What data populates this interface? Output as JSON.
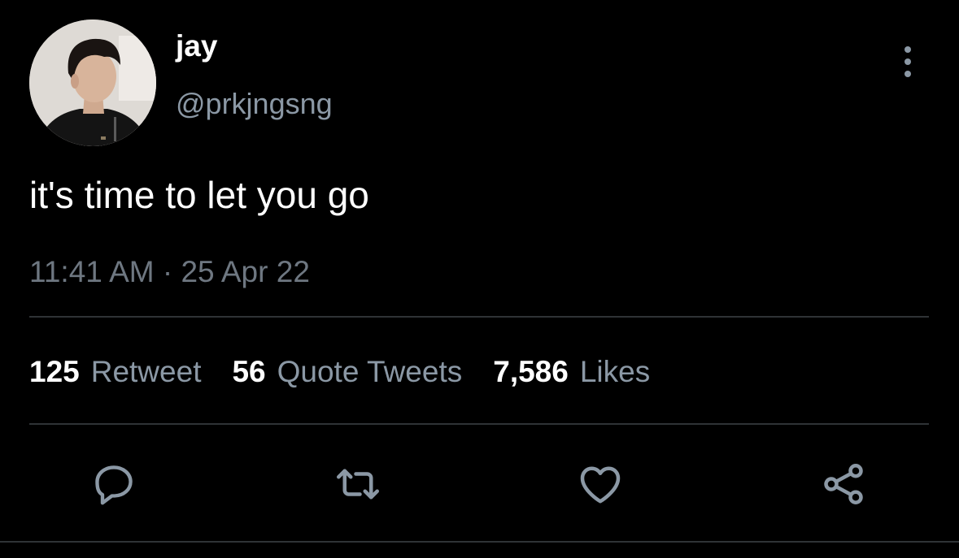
{
  "author": {
    "display_name": "jay",
    "handle": "@prkjngsng"
  },
  "tweet": {
    "text": "it's time to let you go",
    "time": "11:41 AM",
    "separator": " · ",
    "date": "25 Apr 22"
  },
  "stats": [
    {
      "count": "125",
      "label": "Retweet"
    },
    {
      "count": "56",
      "label": "Quote Tweets"
    },
    {
      "count": "7,586",
      "label": "Likes"
    }
  ],
  "icons": {
    "more": "more-vertical-icon",
    "reply": "reply-icon",
    "retweet": "retweet-icon",
    "like": "heart-icon",
    "share": "share-icon"
  },
  "colors": {
    "background": "#000000",
    "primary_text": "#ffffff",
    "secondary_text": "#8b98a5",
    "divider": "#2f3336"
  }
}
